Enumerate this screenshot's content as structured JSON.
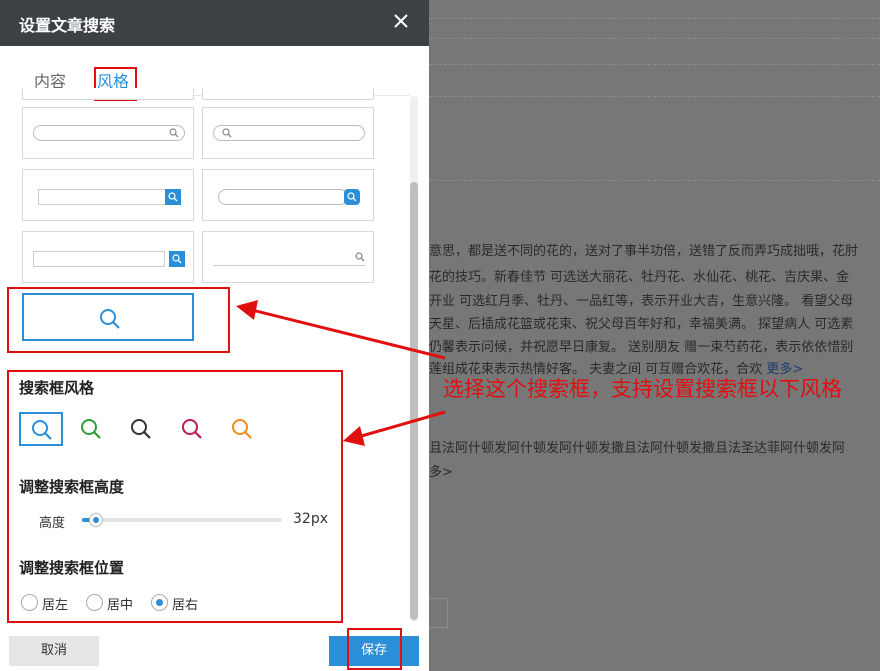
{
  "dialog": {
    "title": "设置文章搜索",
    "tabs": [
      {
        "label": "内容"
      },
      {
        "label": "风格"
      }
    ],
    "active_tab": "风格",
    "style_section_title": "搜索框风格",
    "height_section_title": "调整搜索框高度",
    "height_label": "高度",
    "height_value": "32px",
    "position_section_title": "调整搜索框位置",
    "positions": [
      {
        "label": "居左"
      },
      {
        "label": "居中"
      },
      {
        "label": "居右"
      }
    ],
    "selected_position": "居右",
    "style_colors": [
      "#2a8fd6",
      "#2e9e3a",
      "#333333",
      "#c2185b",
      "#f28b1e"
    ],
    "cancel_label": "取消",
    "save_label": "保存"
  },
  "background_page": {
    "lines": [
      "意思，都是送不同的花的，送对了事半功倍，送错了反而弄巧成拙哦，花肘",
      "花的技巧。新春佳节 可选送大丽花、牡丹花、水仙花、桃花、吉庆果、金",
      "开业 可选红月季、牡丹、一品红等，表示开业大吉，生意兴隆。 看望父母",
      "天星、后插成花篮或花束、祝父母百年好和，幸福美满。 探望病人 可选素",
      "仍馨表示问候，并祝愿早日康复。 送别朋友 赠一束芍药花，表示依依惜别",
      "莲组成花束表示热情好客。 夫妻之间 可互赠合欢花，合欢"
    ],
    "more_link": "更多>",
    "line2": "且法阿什顿发阿什顿发阿什顿发撒且法阿什顿发撒且法圣达菲阿什顿发阿",
    "line2_suffix": "多>"
  },
  "annotation": {
    "text": "选择这个搜索框，支持设置搜索框以下风格"
  },
  "colors": {
    "accent": "#2a8fd6",
    "annotation_red": "#e01010",
    "titlebar": "#3d4146"
  }
}
